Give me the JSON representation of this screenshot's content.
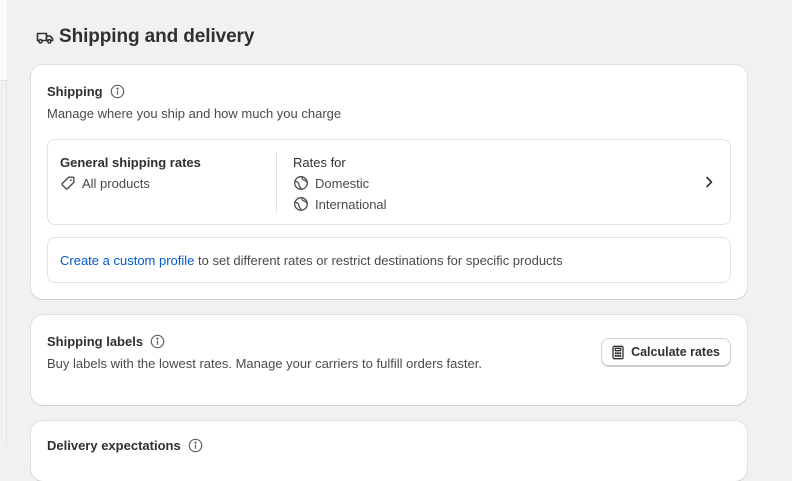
{
  "page": {
    "title": "Shipping and delivery",
    "icon": "truck-icon"
  },
  "shipping": {
    "heading": "Shipping",
    "subtitle": "Manage where you ship and how much you charge",
    "general_rates_title": "General shipping rates",
    "products_label": "All products",
    "rates_for_label": "Rates for",
    "zones": [
      "Domestic",
      "International"
    ],
    "custom_profile_link": "Create a custom profile",
    "custom_profile_text": " to set different rates or restrict destinations for specific products"
  },
  "labels": {
    "heading": "Shipping labels",
    "subtitle": "Buy labels with the lowest rates. Manage your carriers to fulfill orders faster.",
    "button_label": "Calculate rates"
  },
  "delivery": {
    "heading": "Delivery expectations"
  },
  "colors": {
    "background": "#f1f1f1",
    "card": "#ffffff",
    "link": "#005bd3",
    "text": "#303030"
  }
}
